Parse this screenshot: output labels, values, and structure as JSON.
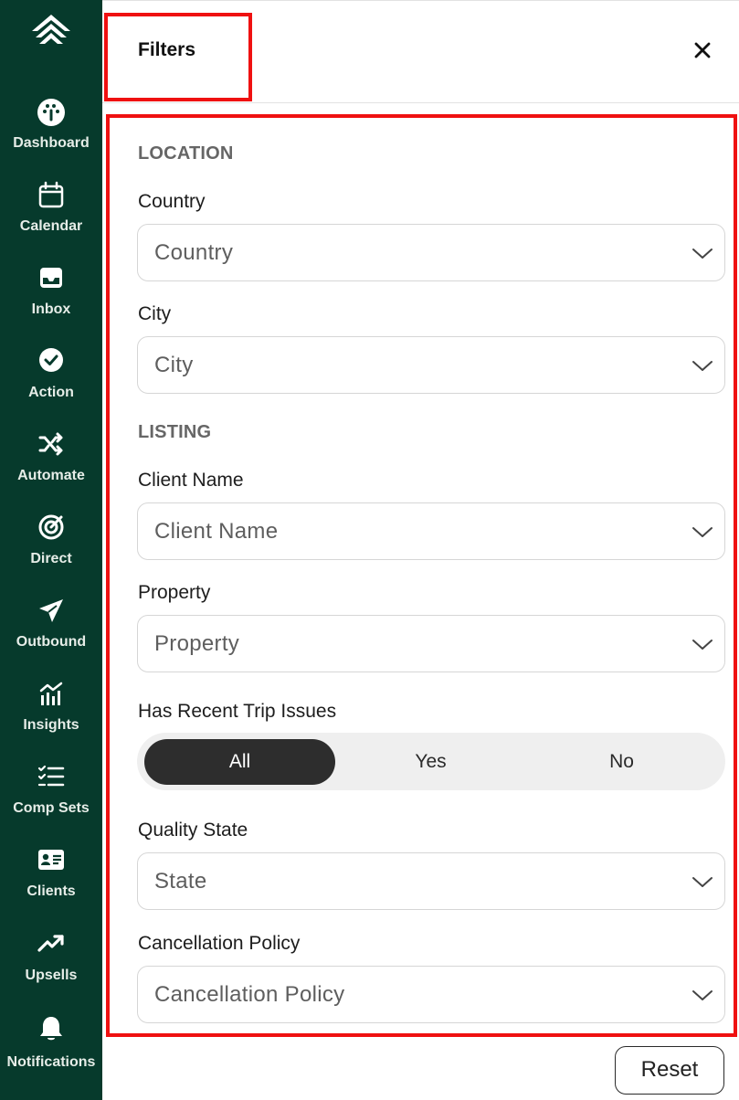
{
  "sidebar": {
    "items": [
      {
        "label": "Dashboard",
        "icon": "dashboard-icon"
      },
      {
        "label": "Calendar",
        "icon": "calendar-icon"
      },
      {
        "label": "Inbox",
        "icon": "inbox-icon"
      },
      {
        "label": "Action",
        "icon": "check-circle-icon"
      },
      {
        "label": "Automate",
        "icon": "shuffle-icon"
      },
      {
        "label": "Direct",
        "icon": "target-icon"
      },
      {
        "label": "Outbound",
        "icon": "send-icon"
      },
      {
        "label": "Insights",
        "icon": "insights-chart-icon"
      },
      {
        "label": "Comp Sets",
        "icon": "checklist-icon"
      },
      {
        "label": "Clients",
        "icon": "id-card-icon"
      },
      {
        "label": "Upsells",
        "icon": "trending-up-icon"
      },
      {
        "label": "Notifications",
        "icon": "bell-icon"
      }
    ]
  },
  "panel": {
    "title": "Filters",
    "close_icon": "close-icon",
    "reset_label": "Reset"
  },
  "location": {
    "heading": "LOCATION",
    "country_label": "Country",
    "country_placeholder": "Country",
    "city_label": "City",
    "city_placeholder": "City"
  },
  "listing": {
    "heading": "LISTING",
    "client_label": "Client Name",
    "client_placeholder": "Client Name",
    "property_label": "Property",
    "property_placeholder": "Property",
    "trip_issues_label": "Has Recent Trip Issues",
    "trip_issues_options": [
      "All",
      "Yes",
      "No"
    ],
    "trip_issues_selected": "All",
    "quality_label": "Quality State",
    "quality_placeholder": "State",
    "cancellation_label": "Cancellation Policy",
    "cancellation_placeholder": "Cancellation Policy"
  },
  "colors": {
    "sidebar_bg": "#063a2c",
    "highlight_border": "#ef1111",
    "segment_active_bg": "#2d2d2d"
  }
}
